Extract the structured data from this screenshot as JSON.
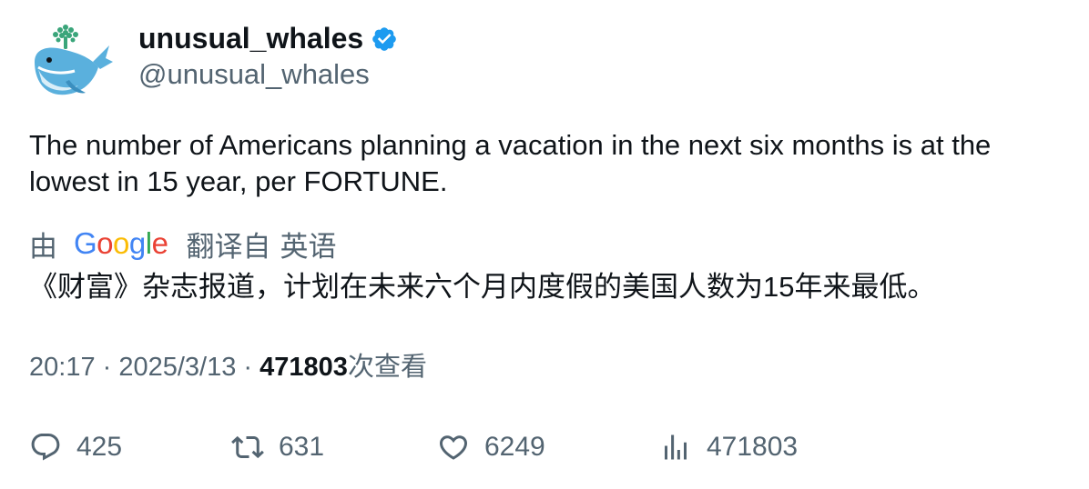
{
  "author": {
    "display_name": "unusual_whales",
    "handle": "@unusual_whales",
    "verified": true,
    "avatar_icon": "whale-logo-icon"
  },
  "tweet": {
    "text": "The number of Americans planning a vacation in the next six months is at the lowest in 15 year, per FORTUNE."
  },
  "translation": {
    "by_label": "由",
    "provider_letters": [
      "G",
      "o",
      "o",
      "g",
      "l",
      "e"
    ],
    "translated_from_label": "翻译自",
    "source_language": "英语",
    "text": "《财富》杂志报道，计划在未来六个月内度假的美国人数为15年来最低。"
  },
  "meta": {
    "time": "20:17",
    "separator": " · ",
    "date": "2025/3/13",
    "views_count": "471803",
    "views_label": "次查看"
  },
  "actions": {
    "reply_count": "425",
    "retweet_count": "631",
    "like_count": "6249",
    "views_count": "471803"
  },
  "colors": {
    "text_primary": "#0f1419",
    "text_secondary": "#536471",
    "verified_blue": "#1d9bf0",
    "google_blue": "#4285F4",
    "google_red": "#EA4335",
    "google_yellow": "#FBBC05",
    "google_green": "#34A853"
  }
}
